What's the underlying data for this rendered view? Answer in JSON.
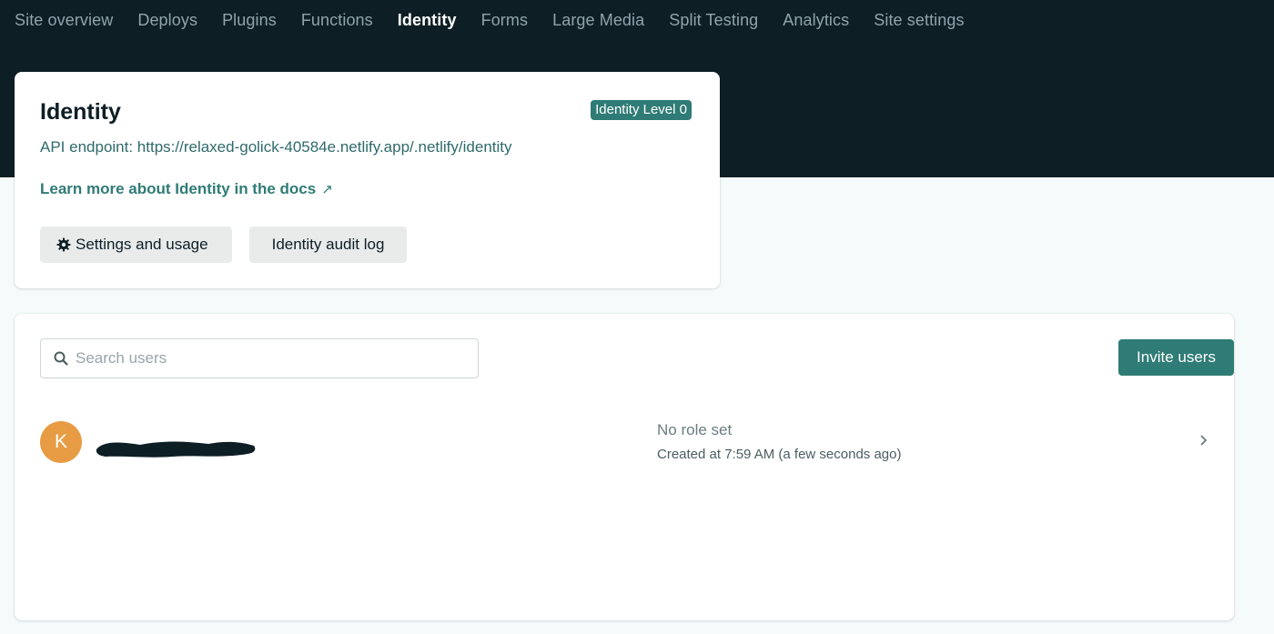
{
  "nav": {
    "items": [
      {
        "label": "Site overview",
        "active": false
      },
      {
        "label": "Deploys",
        "active": false
      },
      {
        "label": "Plugins",
        "active": false
      },
      {
        "label": "Functions",
        "active": false
      },
      {
        "label": "Identity",
        "active": true
      },
      {
        "label": "Forms",
        "active": false
      },
      {
        "label": "Large Media",
        "active": false
      },
      {
        "label": "Split Testing",
        "active": false
      },
      {
        "label": "Analytics",
        "active": false
      },
      {
        "label": "Site settings",
        "active": false
      }
    ]
  },
  "identity": {
    "title": "Identity",
    "badge": "Identity Level 0",
    "api_endpoint": "API endpoint: https://relaxed-golick-40584e.netlify.app/.netlify/identity",
    "docs_link": "Learn more about Identity in the docs",
    "settings_button": "Settings and usage",
    "audit_button": "Identity audit log"
  },
  "users": {
    "search_placeholder": "Search users",
    "search_value": "",
    "invite_button": "Invite users",
    "list": [
      {
        "avatar_initial": "K",
        "role": "No role set",
        "created": "Created at 7:59 AM (a few seconds ago)"
      }
    ]
  },
  "colors": {
    "header_bg": "#0e1e25",
    "accent": "#2f7b75",
    "avatar": "#e79c44",
    "page_bg": "#f5fbfb"
  },
  "icons": {
    "gear": "gear-icon",
    "search": "search-icon",
    "external": "external-link-icon",
    "chevron": "chevron-right-icon"
  }
}
